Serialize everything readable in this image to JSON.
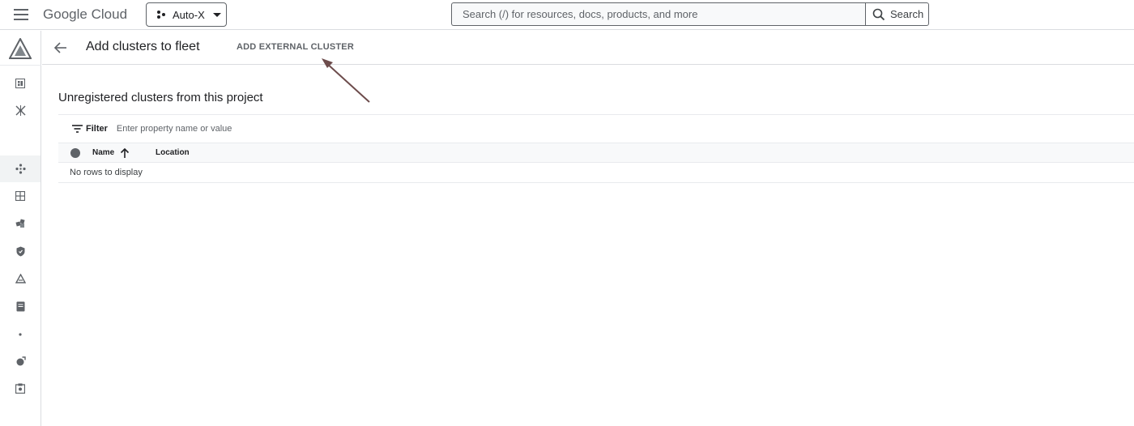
{
  "header": {
    "logo_google": "Google",
    "logo_cloud": "Cloud",
    "project_name": "Auto-X",
    "search_placeholder": "Search (/) for resources, docs, products, and more",
    "search_button_label": "Search"
  },
  "sidenav": {
    "icons": [
      "product-logo-icon",
      "dashboard-icon",
      "hub-icon",
      "fleet-icon",
      "grid-icon",
      "modules-icon",
      "shield-icon",
      "deploy-icon",
      "doc-icon",
      "dot-icon",
      "policy-icon",
      "marketplace-icon"
    ]
  },
  "page": {
    "title": "Add clusters to fleet",
    "add_external_cluster_label": "ADD EXTERNAL CLUSTER"
  },
  "section": {
    "title": "Unregistered clusters from this project"
  },
  "filter": {
    "label": "Filter",
    "placeholder": "Enter property name or value"
  },
  "table": {
    "columns": [
      {
        "label": "Name",
        "sort": "ascending"
      },
      {
        "label": "Location"
      }
    ],
    "rows": [],
    "empty_message": "No rows to display"
  },
  "colors": {
    "accent": "#1a73e8",
    "annotation_arrow": "#6d4c4c",
    "border": "#dadce0"
  }
}
